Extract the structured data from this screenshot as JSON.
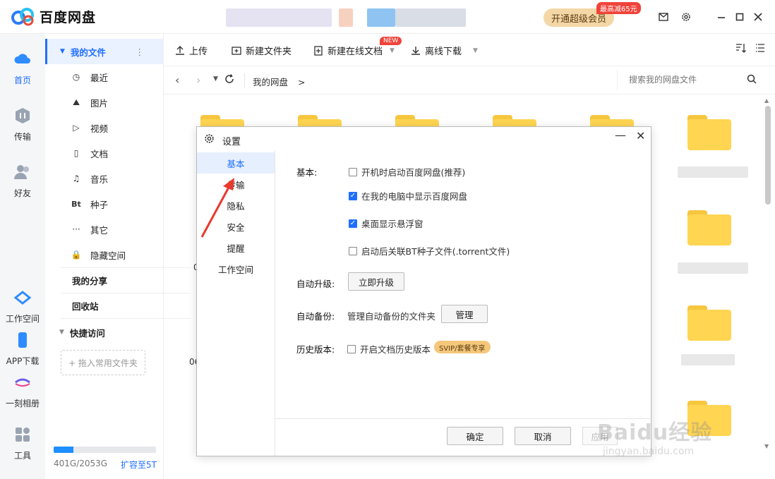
{
  "app": {
    "title": "百度网盘",
    "vip_button": "开通超级会员",
    "vip_badge": "最高减65元"
  },
  "rail": [
    {
      "id": "home",
      "label": "首页",
      "icon": "cloud-icon",
      "active": true
    },
    {
      "id": "transfer",
      "label": "传输",
      "icon": "transfer-icon"
    },
    {
      "id": "friends",
      "label": "好友",
      "icon": "friends-icon"
    },
    {
      "id": "workspace",
      "label": "工作空间",
      "icon": "workspace-icon"
    },
    {
      "id": "app",
      "label": "APP下载",
      "icon": "phone-icon"
    },
    {
      "id": "album",
      "label": "一刻相册",
      "icon": "album-icon"
    },
    {
      "id": "tools",
      "label": "工具",
      "icon": "tools-icon"
    }
  ],
  "sidebar": {
    "my_files": "我的文件",
    "items": [
      {
        "label": "最近",
        "icon": "clock-icon",
        "glyph": "◷"
      },
      {
        "label": "图片",
        "icon": "image-icon",
        "glyph": "⛰"
      },
      {
        "label": "视频",
        "icon": "video-icon",
        "glyph": "▷"
      },
      {
        "label": "文档",
        "icon": "document-icon",
        "glyph": "▯"
      },
      {
        "label": "音乐",
        "icon": "music-icon",
        "glyph": "♫"
      },
      {
        "label": "种子",
        "icon": "torrent-icon",
        "glyph": "Bt"
      },
      {
        "label": "其它",
        "icon": "more-icon",
        "glyph": "···"
      },
      {
        "label": "隐藏空间",
        "icon": "lock-icon",
        "glyph": "🔒"
      }
    ],
    "my_share": "我的分享",
    "recycle": "回收站",
    "quick_access": "快捷访问",
    "drag_hint": "+ 拖入常用文件夹",
    "storage_text": "401G/2053G",
    "storage_fraction": 0.195,
    "expand_link": "扩容至5T"
  },
  "toolbar": {
    "upload": "上传",
    "new_folder": "新建文件夹",
    "new_online_doc": "新建在线文档",
    "new_badge": "NEW",
    "offline_download": "离线下载"
  },
  "nav": {
    "breadcrumb": "我的网盘",
    "breadcrumb_sep": ">",
    "search_placeholder": "搜索我的网盘文件"
  },
  "grid": {
    "partial_label_1": "0",
    "partial_label_2": "06"
  },
  "dialog": {
    "title": "设置",
    "nav": [
      {
        "label": "基本",
        "active": true
      },
      {
        "label": "传输"
      },
      {
        "label": "隐私"
      },
      {
        "label": "安全"
      },
      {
        "label": "提醒"
      },
      {
        "label": "工作空间"
      }
    ],
    "basic_label": "基本:",
    "options": [
      {
        "label": "开机时启动百度网盘(推荐)",
        "checked": false
      },
      {
        "label": "在我的电脑中显示百度网盘",
        "checked": true
      },
      {
        "label": "桌面显示悬浮窗",
        "checked": true
      },
      {
        "label": "启动后关联BT种子文件(.torrent文件)",
        "checked": false
      }
    ],
    "auto_upgrade_label": "自动升级:",
    "upgrade_now": "立即升级",
    "auto_backup_label": "自动备份:",
    "auto_backup_text": "管理自动备份的文件夹",
    "manage": "管理",
    "history_label": "历史版本:",
    "history_option": "开启文档历史版本",
    "history_checked": false,
    "svip_tag": "SVIP/套餐专享",
    "ok": "确定",
    "cancel": "取消",
    "apply": "应用"
  },
  "watermark": {
    "logo": "Baidu经验",
    "url": "jingyan.baidu.com"
  },
  "colors": {
    "accent": "#1f6fff",
    "folder": "#ffd552",
    "vip": "#f4d7a6",
    "arrow": "#e8392f"
  }
}
